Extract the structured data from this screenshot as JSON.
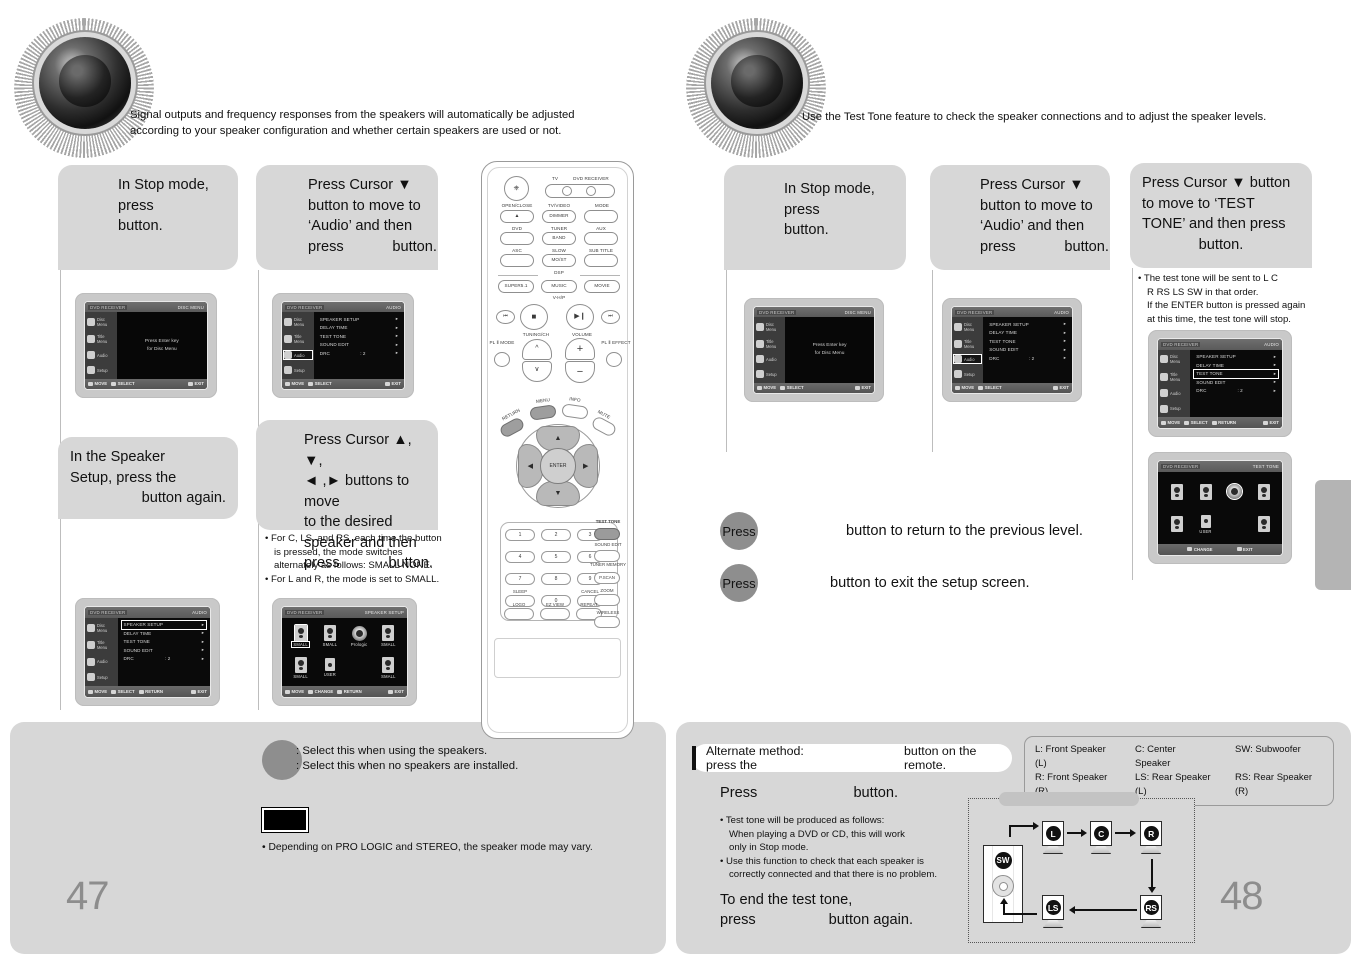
{
  "left_page": {
    "page_number": "47",
    "intro": {
      "line1": "Signal outputs and frequency responses from the speakers will automatically be adjusted",
      "line2": "according to your speaker configuration and whether certain speakers are used or not."
    },
    "steps": [
      {
        "id": "step1",
        "lines": [
          "In Stop mode,",
          "press",
          "button."
        ]
      },
      {
        "id": "step2",
        "lines": [
          "Press Cursor ▼",
          "button to move to",
          "‘Audio’ and then",
          "press            button."
        ]
      },
      {
        "id": "step3",
        "lines": [
          "In the Speaker",
          "Setup, press the",
          "button again."
        ]
      },
      {
        "id": "step4",
        "lines": [
          "Press Cursor ▲, ▼,",
          "◄ ,► buttons to move",
          "to the desired",
          "speaker and then",
          "press            button."
        ]
      }
    ],
    "step4_notes": [
      "• For C, LS, and RS, each time the button",
      "is pressed, the mode switches",
      "alternately as follows: SMALL      NONE.",
      "• For L and R, the mode is set to SMALL."
    ],
    "tv_screens": {
      "disc_menu": {
        "header_left": "DVD RECEIVER",
        "header_right": "DISC MENU",
        "body_line1": "Press Enter key",
        "body_line2": "for Disc Menu",
        "side_items": [
          "Disc Menu",
          "Title Menu",
          "Audio",
          "Setup"
        ],
        "footer": [
          "MOVE",
          "SELECT",
          "EXIT"
        ]
      },
      "audio_menu": {
        "header_left": "DVD RECEIVER",
        "header_right": "AUDIO",
        "rows": [
          {
            "label": "SPEAKER SETUP",
            "value": ""
          },
          {
            "label": "DELAY TIME",
            "value": ""
          },
          {
            "label": "TEST TONE",
            "value": ""
          },
          {
            "label": "SOUND EDIT",
            "value": ""
          },
          {
            "label": "DRC",
            "value": ": 2"
          }
        ],
        "selected_row": -1,
        "selected_side": 2,
        "side_items": [
          "Disc Menu",
          "Title Menu",
          "Audio",
          "Setup"
        ],
        "footer": [
          "MOVE",
          "SELECT",
          "EXIT"
        ]
      },
      "audio_selected": {
        "header_left": "DVD RECEIVER",
        "header_right": "AUDIO",
        "rows": [
          {
            "label": "SPEAKER SETUP",
            "value": ""
          },
          {
            "label": "DELAY TIME",
            "value": ""
          },
          {
            "label": "TEST TONE",
            "value": ""
          },
          {
            "label": "SOUND EDIT",
            "value": ""
          },
          {
            "label": "DRC",
            "value": ": 2"
          }
        ],
        "selected_row": 0,
        "side_items": [
          "Disc Menu",
          "Title Menu",
          "Audio",
          "Setup"
        ],
        "footer": [
          "MOVE",
          "SELECT",
          "RETURN",
          "EXIT"
        ]
      },
      "speaker_setup": {
        "header_left": "DVD RECEIVER",
        "header_right": "SPEAKER SETUP",
        "cells": [
          {
            "pos": "L",
            "caption": "SMALL",
            "selected": true,
            "type": "speaker"
          },
          {
            "pos": "C",
            "caption": "SMALL",
            "selected": false,
            "type": "speaker"
          },
          {
            "pos": "PL",
            "caption": "Prologic",
            "selected": false,
            "type": "round"
          },
          {
            "pos": "R",
            "caption": "SMALL",
            "selected": false,
            "type": "speaker"
          },
          {
            "pos": "LS",
            "caption": "SMALL",
            "selected": false,
            "type": "speaker"
          },
          {
            "pos": "SW",
            "caption": "USER",
            "selected": false,
            "type": "sub"
          },
          {
            "pos": "",
            "caption": "",
            "selected": false,
            "type": "empty"
          },
          {
            "pos": "RS",
            "caption": "SMALL",
            "selected": false,
            "type": "speaker"
          }
        ],
        "footer": [
          "MOVE",
          "CHANGE",
          "RETURN",
          "EXIT"
        ]
      }
    },
    "footer": {
      "legend_line1": ": Select this when using the speakers.",
      "legend_line2": ": Select this when no speakers are installed.",
      "note": "• Depending on PRO LOGIC and STEREO, the speaker mode may vary."
    }
  },
  "right_page": {
    "page_number": "48",
    "intro": {
      "line1": "Use the Test Tone feature to check the speaker connections and to adjust the speaker levels."
    },
    "steps": [
      {
        "id": "step1",
        "lines": [
          "In Stop mode,",
          "press",
          "button."
        ]
      },
      {
        "id": "step2",
        "lines": [
          "Press Cursor ▼",
          "button to move to",
          "‘Audio’ and then",
          "press            button."
        ]
      },
      {
        "id": "step3",
        "lines": [
          "Press Cursor ▼ button",
          "to move to ‘TEST",
          "TONE’ and then press",
          "button."
        ]
      }
    ],
    "step3_notes": [
      "• The test tone will be sent to L       C",
      "R      RS      LS      SW in that order.",
      "If the ENTER button is pressed again",
      "at this time, the test tone will stop."
    ],
    "press_rows": [
      {
        "bubble": "Press",
        "text": "button to return to the previous level."
      },
      {
        "bubble": "Press",
        "text": "button to exit the setup screen."
      }
    ],
    "tv_screens": {
      "disc_menu": {
        "header_left": "DVD RECEIVER",
        "header_right": "DISC MENU",
        "body_line1": "Press Enter key",
        "body_line2": "for Disc Menu",
        "side_items": [
          "Disc Menu",
          "Title Menu",
          "Audio",
          "Setup"
        ],
        "footer": [
          "MOVE",
          "SELECT",
          "EXIT"
        ]
      },
      "audio_menu": {
        "header_left": "DVD RECEIVER",
        "header_right": "AUDIO",
        "rows": [
          {
            "label": "SPEAKER SETUP",
            "value": ""
          },
          {
            "label": "DELAY TIME",
            "value": ""
          },
          {
            "label": "TEST TONE",
            "value": ""
          },
          {
            "label": "SOUND EDIT",
            "value": ""
          },
          {
            "label": "DRC",
            "value": ": 2"
          }
        ],
        "selected_row": -1,
        "side_items": [
          "Disc Menu",
          "Title Menu",
          "Audio",
          "Setup"
        ],
        "footer": [
          "MOVE",
          "SELECT",
          "EXIT"
        ]
      },
      "test_tone_menu": {
        "header_left": "DVD RECEIVER",
        "header_right": "AUDIO",
        "rows": [
          {
            "label": "SPEAKER SETUP",
            "value": ""
          },
          {
            "label": "DELAY TIME",
            "value": ""
          },
          {
            "label": "TEST TONE",
            "value": ""
          },
          {
            "label": "SOUND EDIT",
            "value": ""
          },
          {
            "label": "DRC",
            "value": ": 2"
          }
        ],
        "selected_row": 2,
        "side_items": [
          "Disc Menu",
          "Title Menu",
          "Audio",
          "Setup"
        ],
        "footer": [
          "MOVE",
          "SELECT",
          "RETURN",
          "EXIT"
        ]
      },
      "test_tone_screen": {
        "header_left": "DVD RECEIVER",
        "header_right": "TEST TONE",
        "cells": [
          {
            "pos": "L",
            "caption": "",
            "selected": false,
            "type": "speaker"
          },
          {
            "pos": "C",
            "caption": "",
            "selected": false,
            "type": "speaker"
          },
          {
            "pos": "PL",
            "caption": "",
            "selected": true,
            "type": "round"
          },
          {
            "pos": "R",
            "caption": "",
            "selected": false,
            "type": "speaker"
          },
          {
            "pos": "LS",
            "caption": "",
            "selected": false,
            "type": "speaker"
          },
          {
            "pos": "SW",
            "caption": "USER",
            "selected": false,
            "type": "sub"
          },
          {
            "pos": "",
            "caption": "",
            "selected": false,
            "type": "empty"
          },
          {
            "pos": "RS",
            "caption": "",
            "selected": false,
            "type": "speaker"
          }
        ],
        "footer": [
          "CHANGE",
          "EXIT"
        ]
      }
    },
    "footer": {
      "alt_method": {
        "prefix": "Alternate method: press the",
        "suffix": "button on the remote."
      },
      "legend": [
        "L: Front Speaker (L)",
        "C: Center Speaker",
        "SW: Subwoofer",
        "R: Front Speaker (R)",
        "LS: Rear Speaker (L)",
        "RS: Rear Speaker (R)"
      ],
      "press_line": {
        "word": "Press",
        "rest": "button."
      },
      "notes": [
        "• Test tone will be produced as follows:",
        "When playing a DVD or CD, this will work",
        "only in Stop mode.",
        "• Use this function to check that each speaker is",
        "correctly connected and that there is no problem."
      ],
      "end_lines": [
        "To end the test tone,",
        "press                  button again."
      ],
      "diagram_nodes": [
        "L",
        "C",
        "R",
        "RS",
        "LS",
        "SW"
      ]
    }
  },
  "remote": {
    "power_icon": "power-icon",
    "mode_labels": {
      "tv": "TV",
      "dvd_receiver": "DVD RECEIVER"
    },
    "row_labels_1": [
      "OPEN/CLOSE",
      "TV/VIDEO",
      "MODE"
    ],
    "row_btn_1": [
      "▲",
      "DIMMER",
      ""
    ],
    "row_labels_2": [
      "DVD",
      "TUNER",
      "AUX"
    ],
    "row_btn_2": [
      "",
      "BAND",
      ""
    ],
    "row_labels_3": [
      "ASC",
      "SLOW",
      "SUB TITLE"
    ],
    "row_btn_3": [
      "",
      "MO/ST",
      ""
    ],
    "dsp_label": "DSP",
    "row_labels_4": [
      "SUPER5.1",
      "MUSIC",
      "MOVIE"
    ],
    "vhp_label": "V-H/P",
    "transport": [
      "⏮",
      "■",
      "▶❙",
      "⏭"
    ],
    "tuning_label": "TUNING/CH",
    "volume_label": "VOLUME",
    "pl_mode_label": "PL Ⅱ MODE",
    "pl_effect_label": "PL Ⅱ EFFECT",
    "menu_label": "MENU",
    "info_label": "INFO",
    "return_label": "RETURN",
    "mute_label": "MUTE",
    "enter_label": "ENTER",
    "numbers": [
      "1",
      "2",
      "3",
      "4",
      "5",
      "6",
      "7",
      "8",
      "9",
      "0"
    ],
    "test_tone_label": "TEST TONE",
    "sound_edit_label": "SOUND EDIT",
    "tuner_memory_label": "TUNER MEMORY",
    "pscan_label": "P.SCAN",
    "sleep_label": "SLEEP",
    "cancel_label": "CANCEL",
    "zoom_label": "ZOOM",
    "logo_label": "LOGO",
    "ezview_label": "EZ VIEW",
    "repeat_label": "REPEAT",
    "wireless_label": "WIRELESS"
  }
}
